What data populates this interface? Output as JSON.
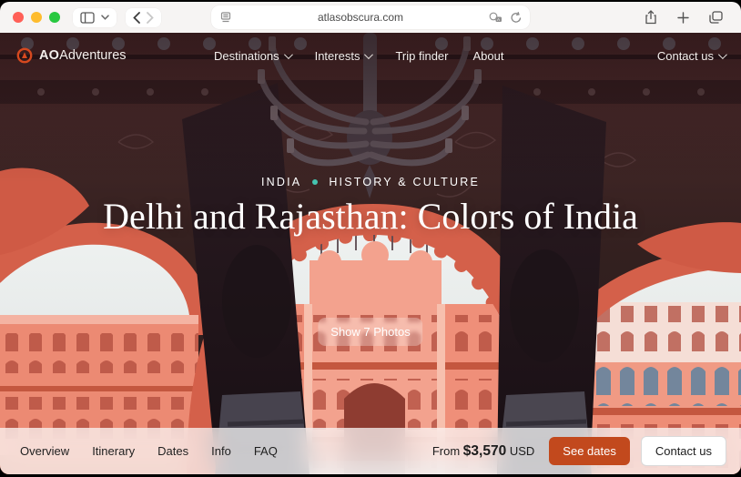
{
  "browser": {
    "url": "atlasobscura.com",
    "traffic_lights": {
      "close": "#ff5f57",
      "minimize": "#febc2e",
      "zoom": "#28c840"
    }
  },
  "nav": {
    "logo": {
      "bold": "AO",
      "rest": "Adventures",
      "ring_color": "#d6491f"
    },
    "items": [
      {
        "label": "Destinations",
        "has_dropdown": true
      },
      {
        "label": "Interests",
        "has_dropdown": true
      },
      {
        "label": "Trip finder",
        "has_dropdown": false
      },
      {
        "label": "About",
        "has_dropdown": false
      }
    ],
    "contact": {
      "label": "Contact us",
      "has_dropdown": true
    }
  },
  "hero": {
    "breadcrumb": {
      "country": "INDIA",
      "category": "HISTORY & CULTURE",
      "dot_color": "#45c4b0"
    },
    "title": "Delhi and Rajasthan: Colors of India",
    "photos_button": "Show 7 Photos"
  },
  "bottom_bar": {
    "tabs": [
      {
        "label": "Overview"
      },
      {
        "label": "Itinerary"
      },
      {
        "label": "Dates"
      },
      {
        "label": "Info"
      },
      {
        "label": "FAQ"
      }
    ],
    "price": {
      "prefix": "From",
      "amount": "$3,570",
      "currency": "USD"
    },
    "see_dates_label": "See dates",
    "contact_label": "Contact us"
  },
  "colors": {
    "accent_orange": "#c2491d",
    "arch_red": "#d4604a",
    "wall_maroon": "#3a2226",
    "sky": "#e9edec"
  }
}
